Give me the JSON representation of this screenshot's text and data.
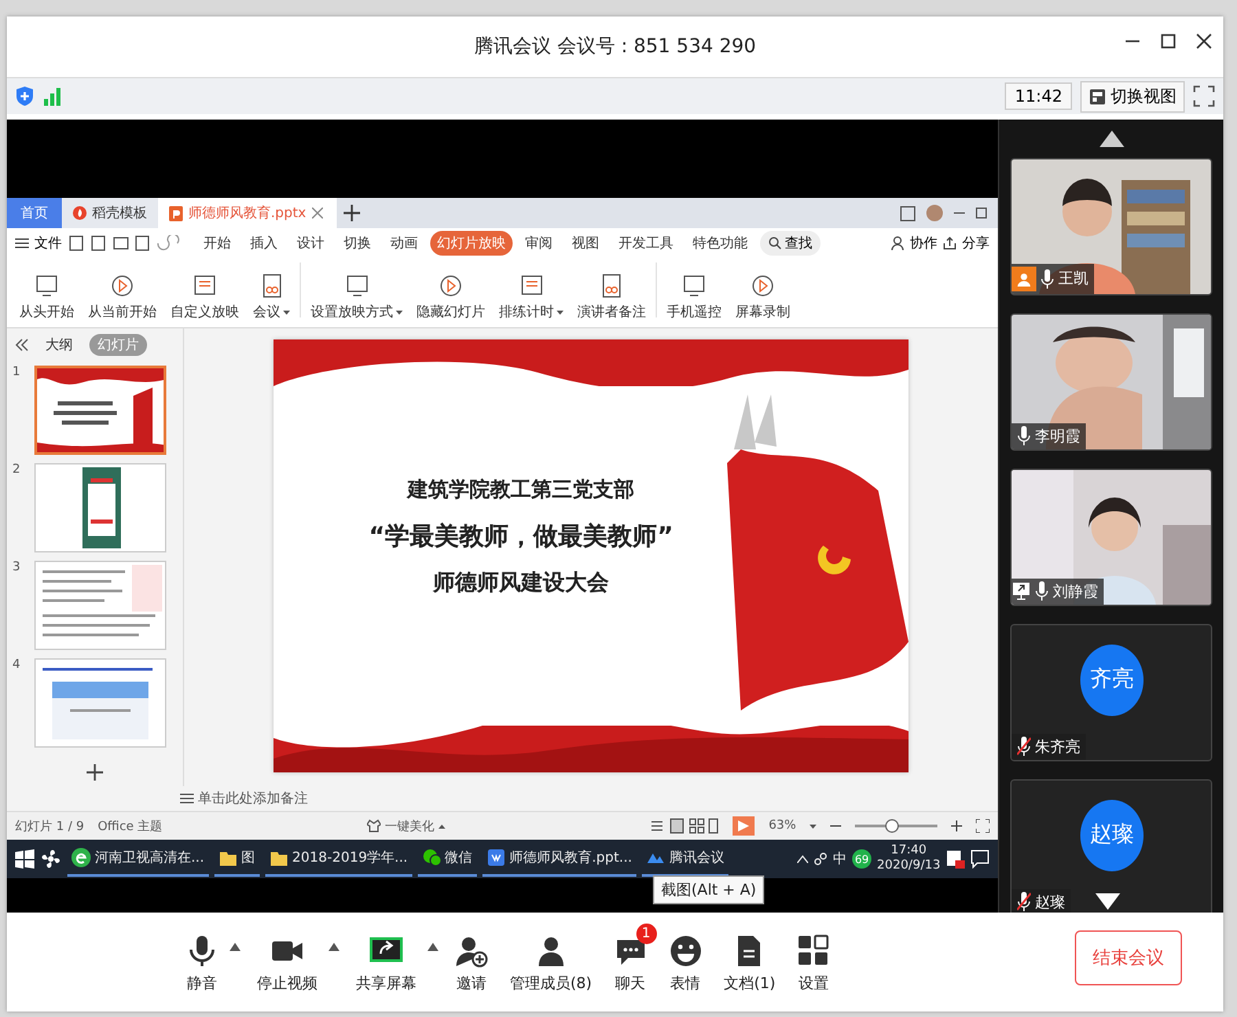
{
  "window": {
    "title": "腾讯会议 会议号 : 851 534 290"
  },
  "top_bar": {
    "time": "11:42",
    "view_switch": "切换视图"
  },
  "shared_screen": {
    "app_tabs": [
      {
        "label": "首页",
        "kind": "home",
        "selected": false
      },
      {
        "label": "稻壳模板",
        "kind": "template",
        "selected": false
      },
      {
        "label": "师德师风教育.pptx",
        "kind": "file",
        "selected": true
      }
    ],
    "file_menu": "文件",
    "ribbon_tabs": [
      {
        "label": "开始",
        "selected": false
      },
      {
        "label": "插入",
        "selected": false
      },
      {
        "label": "设计",
        "selected": false
      },
      {
        "label": "切换",
        "selected": false
      },
      {
        "label": "动画",
        "selected": false
      },
      {
        "label": "幻灯片放映",
        "selected": true
      },
      {
        "label": "审阅",
        "selected": false
      },
      {
        "label": "视图",
        "selected": false
      },
      {
        "label": "开发工具",
        "selected": false
      },
      {
        "label": "特色功能",
        "selected": false
      }
    ],
    "search": "查找",
    "actions": [
      "协作",
      "分享"
    ],
    "tools": [
      {
        "label": "从头开始",
        "dropdown": false
      },
      {
        "label": "从当前开始",
        "dropdown": false
      },
      {
        "label": "自定义放映",
        "dropdown": false
      },
      {
        "label": "会议",
        "dropdown": true
      },
      {
        "label": "设置放映方式",
        "dropdown": true
      },
      {
        "label": "隐藏幻灯片",
        "dropdown": false
      },
      {
        "label": "排练计时",
        "dropdown": true
      },
      {
        "label": "演讲者备注",
        "dropdown": false
      },
      {
        "label": "手机遥控",
        "dropdown": false
      },
      {
        "label": "屏幕录制",
        "dropdown": false
      }
    ],
    "panel_tabs": [
      {
        "label": "大纲",
        "selected": false
      },
      {
        "label": "幻灯片",
        "selected": true
      }
    ],
    "slides": [
      {
        "number": "1",
        "kind": "title",
        "selected": true
      },
      {
        "number": "2",
        "kind": "poster",
        "selected": false
      },
      {
        "number": "3",
        "kind": "text",
        "selected": false
      },
      {
        "number": "4",
        "kind": "web",
        "selected": false
      }
    ],
    "slide": {
      "lines": [
        "建筑学院教工第三党支部",
        "“学最美教师，做最美教师”",
        "师德师风建设大会"
      ]
    },
    "notes_placeholder": "单击此处添加备注",
    "status": {
      "slide_count": "幻灯片 1 / 9",
      "theme": "Office 主题",
      "beautify": "一键美化",
      "zoom": "63%",
      "zoom_slider": {
        "level": 0.45
      }
    },
    "taskbar": {
      "items": [
        {
          "label": "河南卫视高清在...",
          "kind": "browser"
        },
        {
          "label": "图",
          "kind": "folder"
        },
        {
          "label": "2018-2019学年...",
          "kind": "folder"
        },
        {
          "label": "微信",
          "kind": "wechat"
        },
        {
          "label": "师德师风教育.ppt...",
          "kind": "wps"
        },
        {
          "label": "腾讯会议",
          "kind": "meeting"
        }
      ],
      "ime": "中",
      "badge": "69",
      "time": "17:40",
      "date": "2020/9/13"
    },
    "tooltip": "截图(Alt + A)"
  },
  "participants": [
    {
      "name": "王凯",
      "kind": "video",
      "host": true,
      "sharing": false,
      "muted": false
    },
    {
      "name": "李明霞",
      "kind": "video",
      "host": false,
      "sharing": false,
      "muted": false
    },
    {
      "name": "刘静霞",
      "kind": "video",
      "host": false,
      "sharing": true,
      "muted": false
    },
    {
      "name": "朱齐亮",
      "kind": "avatar",
      "avatar_text": "齐亮",
      "host": false,
      "sharing": false,
      "muted": true
    },
    {
      "name": "赵璨",
      "kind": "avatar",
      "avatar_text": "赵璨",
      "host": false,
      "sharing": false,
      "muted": true
    }
  ],
  "toolbar": [
    {
      "label": "静音",
      "kind": "mic",
      "caret": true
    },
    {
      "label": "停止视频",
      "kind": "camera",
      "caret": true
    },
    {
      "label": "共享屏幕",
      "kind": "share",
      "caret": true
    },
    {
      "label": "邀请",
      "kind": "invite",
      "caret": false
    },
    {
      "label": "管理成员(8)",
      "kind": "members",
      "caret": false
    },
    {
      "label": "聊天",
      "kind": "chat",
      "caret": false,
      "badge": "1"
    },
    {
      "label": "表情",
      "kind": "emoji",
      "caret": false
    },
    {
      "label": "文档(1)",
      "kind": "docs",
      "caret": false
    },
    {
      "label": "设置",
      "kind": "settings",
      "caret": false
    }
  ],
  "end_button": "结束会议"
}
